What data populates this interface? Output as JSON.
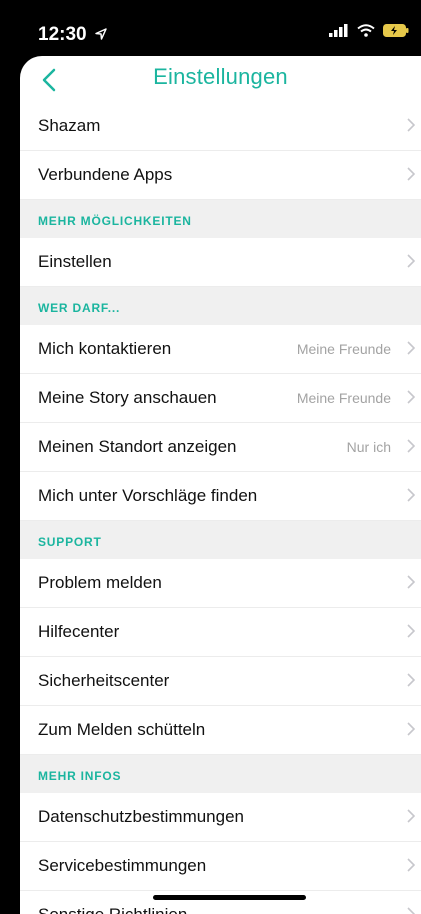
{
  "status": {
    "time": "12:30"
  },
  "header": {
    "title": "Einstellungen"
  },
  "rows_top": [
    {
      "label": "Shazam"
    },
    {
      "label": "Verbundene Apps"
    }
  ],
  "sections": [
    {
      "title": "MEHR MÖGLICHKEITEN",
      "rows": [
        {
          "label": "Einstellen"
        }
      ]
    },
    {
      "title": "WER DARF...",
      "rows": [
        {
          "label": "Mich kontaktieren",
          "value": "Meine Freunde"
        },
        {
          "label": "Meine Story anschauen",
          "value": "Meine Freunde"
        },
        {
          "label": "Meinen Standort anzeigen",
          "value": "Nur ich"
        },
        {
          "label": "Mich unter Vorschläge finden"
        }
      ]
    },
    {
      "title": "SUPPORT",
      "rows": [
        {
          "label": "Problem melden"
        },
        {
          "label": "Hilfecenter"
        },
        {
          "label": "Sicherheitscenter"
        },
        {
          "label": "Zum Melden schütteln"
        }
      ]
    },
    {
      "title": "MEHR INFOS",
      "rows": [
        {
          "label": "Datenschutzbestimmungen"
        },
        {
          "label": "Servicebestimmungen"
        },
        {
          "label": "Sonstige Richtlinien"
        }
      ]
    }
  ],
  "colors": {
    "accent": "#1bb59f",
    "section_bg": "#f0f0f0",
    "value_text": "#a3a3a3"
  },
  "icons": [
    "location-arrow-icon",
    "signal-icon",
    "wifi-icon",
    "battery-icon",
    "back-chevron-icon",
    "chevron-right-icon"
  ]
}
